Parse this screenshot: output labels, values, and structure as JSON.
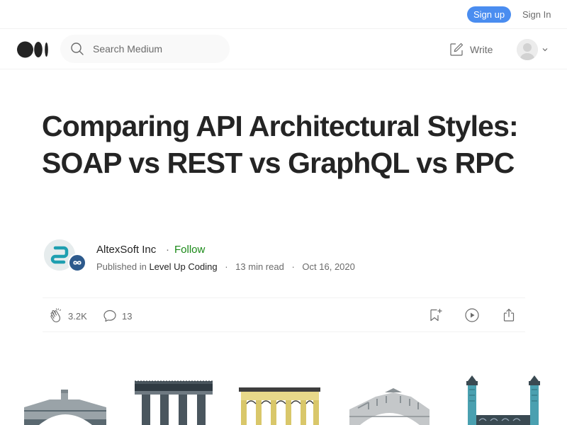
{
  "topbar": {
    "signup_label": "Sign up",
    "signin_label": "Sign In"
  },
  "nav": {
    "search_placeholder": "Search Medium",
    "write_label": "Write"
  },
  "article": {
    "title": "Comparing API Architectural Styles: SOAP vs REST vs GraphQL vs RPC",
    "author_name": "AltexSoft Inc",
    "separator": "·",
    "follow_label": "Follow",
    "published_in_label": "Published in",
    "publication": "Level Up Coding",
    "read_time": "13 min read",
    "date": "Oct 16, 2020"
  },
  "actions": {
    "claps": "3.2K",
    "responses": "13"
  },
  "colors": {
    "accent": "#4a8df0",
    "follow": "#1a8917",
    "text": "#242424",
    "muted": "#6b6b6b"
  },
  "icons": [
    "medium-logo-icon",
    "search-icon",
    "write-icon",
    "avatar",
    "chevron-down-icon",
    "clap-icon",
    "comment-icon",
    "bookmark-icon",
    "play-icon",
    "share-icon"
  ]
}
